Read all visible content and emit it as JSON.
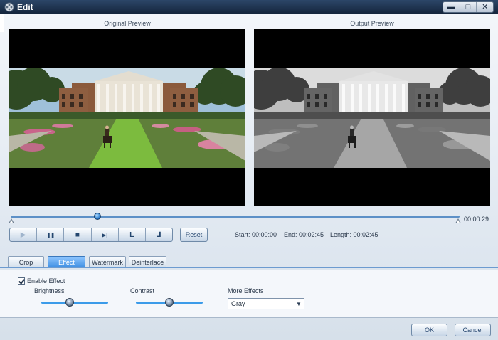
{
  "window": {
    "title": "Edit",
    "icons": {
      "app": "film-reel-icon",
      "minimize": "minimize-icon",
      "maximize": "maximize-icon",
      "close": "close-icon"
    }
  },
  "previews": {
    "original_label": "Original Preview",
    "output_label": "Output Preview",
    "output_mode": "grayscale"
  },
  "timeline": {
    "position_fraction": 0.19,
    "duration": "00:00:29"
  },
  "transport": {
    "buttons": [
      {
        "name": "play-icon",
        "glyph": "▶",
        "enabled": false
      },
      {
        "name": "pause-icon",
        "glyph": "❚❚",
        "enabled": true
      },
      {
        "name": "stop-icon",
        "glyph": "■",
        "enabled": true
      },
      {
        "name": "next-frame-icon",
        "glyph": "▶|",
        "enabled": true
      },
      {
        "name": "set-start-icon",
        "glyph": "L",
        "enabled": true
      },
      {
        "name": "set-end-icon",
        "glyph": "⅃",
        "enabled": true
      }
    ],
    "reset_label": "Reset"
  },
  "times": {
    "start": "Start: 00:00:00",
    "end": "End: 00:02:45",
    "length": "Length: 00:02:45"
  },
  "tabs": [
    {
      "label": "Crop",
      "active": false
    },
    {
      "label": "Effect",
      "active": true
    },
    {
      "label": "Watermark",
      "active": false
    },
    {
      "label": "Deinterlace",
      "active": false
    }
  ],
  "effect": {
    "enable_label": "Enable Effect",
    "enabled": true,
    "brightness_label": "Brightness",
    "brightness_level": 0.42,
    "contrast_label": "Contrast",
    "contrast_level": 0.5,
    "more_effects_label": "More Effects",
    "more_effects_value": "Gray"
  },
  "dialog": {
    "ok_label": "OK",
    "cancel_label": "Cancel"
  },
  "colors": {
    "titlebar": "#1f3552",
    "accent": "#3f8fe2",
    "slider_track": "#5d90c7"
  }
}
